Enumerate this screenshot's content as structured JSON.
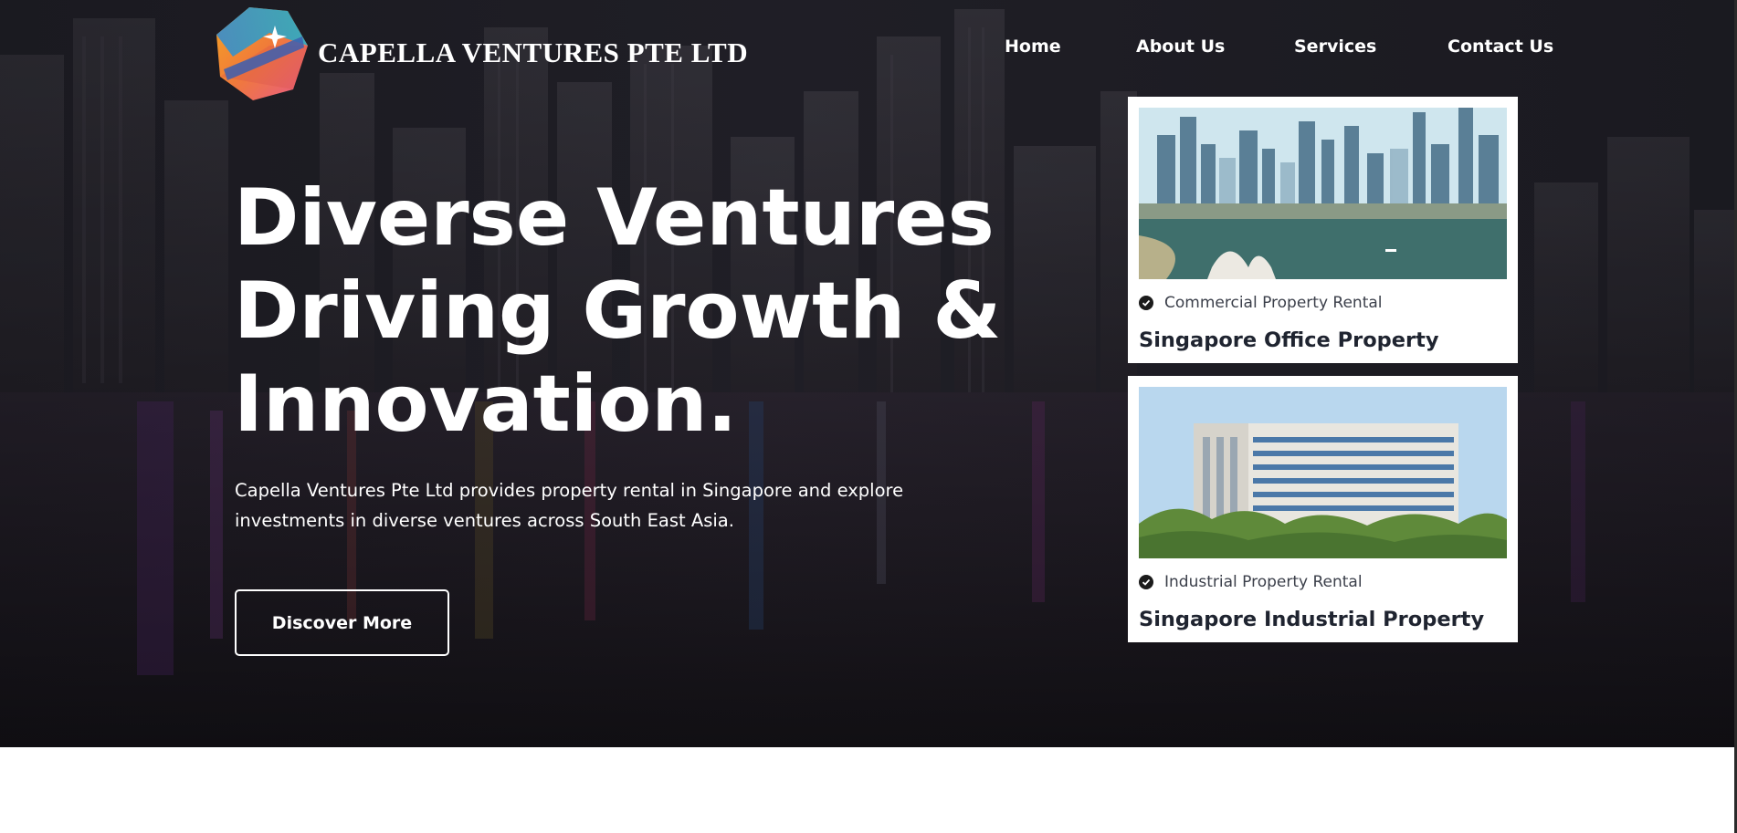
{
  "brand": {
    "name": "CAPELLA VENTURES PTE LTD",
    "logo_icon": "hexagon-star-logo-icon"
  },
  "nav": {
    "items": [
      {
        "label": "Home"
      },
      {
        "label": "About Us"
      },
      {
        "label": "Services"
      },
      {
        "label": "Contact Us"
      }
    ]
  },
  "hero": {
    "headline_lines": [
      "Diverse Ventures",
      "Driving Growth &",
      "Innovation."
    ],
    "description": "Capella Ventures Pte Ltd provides property rental in Singapore and explore investments in diverse ventures across South East Asia.",
    "cta_label": "Discover More"
  },
  "cards": [
    {
      "category": "Commercial Property Rental",
      "title": "Singapore Office Property",
      "check_icon": "check-circle-icon"
    },
    {
      "category": "Industrial Property Rental",
      "title": "Singapore Industrial Property",
      "check_icon": "check-circle-icon"
    }
  ],
  "colors": {
    "hero_overlay": "#1c1b22",
    "card_title": "#1f2430",
    "card_category": "#3b3f4a",
    "text_on_dark": "#ffffff"
  }
}
